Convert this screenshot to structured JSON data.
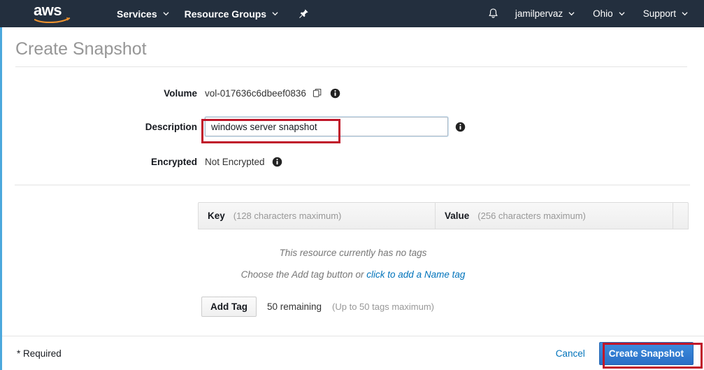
{
  "navbar": {
    "logo_text": "aws",
    "items": [
      {
        "label": "Services",
        "has_caret": true
      },
      {
        "label": "Resource Groups",
        "has_caret": true
      }
    ],
    "pin_icon": "pushpin-icon",
    "bell_icon": "notifications-bell-icon",
    "right_items": [
      {
        "label": "jamilpervaz",
        "has_caret": true
      },
      {
        "label": "Ohio",
        "has_caret": true
      },
      {
        "label": "Support",
        "has_caret": true
      }
    ]
  },
  "page": {
    "title": "Create Snapshot"
  },
  "form": {
    "volume": {
      "label": "Volume",
      "value": "vol-017636c6dbeef0836",
      "copy_icon": "copy-icon",
      "info_icon": "info-icon"
    },
    "description": {
      "label": "Description",
      "value": "windows server snapshot",
      "placeholder": "",
      "info_icon": "info-icon"
    },
    "encrypted": {
      "label": "Encrypted",
      "value": "Not Encrypted",
      "info_icon": "info-icon"
    }
  },
  "tags": {
    "columns": [
      {
        "name": "Key",
        "hint": "(128 characters maximum)"
      },
      {
        "name": "Value",
        "hint": "(256 characters maximum)"
      }
    ],
    "empty_message": "This resource currently has no tags",
    "empty_hint_prefix": "Choose the Add tag button or ",
    "empty_hint_link": "click to add a Name tag",
    "add_tag_label": "Add Tag",
    "remaining_text": "50 remaining",
    "max_hint": "(Up to 50 tags maximum)"
  },
  "footer": {
    "required_note": "* Required",
    "cancel_label": "Cancel",
    "submit_label": "Create Snapshot"
  },
  "colors": {
    "nav_background": "#232f3e",
    "accent_blue": "#0073bb",
    "primary_button": "#2a6fc6",
    "annotation_red": "#c0172a",
    "modal_edge": "#4ca8dd",
    "logo_smile": "#ec912d"
  }
}
